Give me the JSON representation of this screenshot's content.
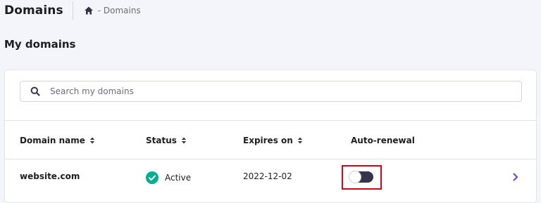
{
  "header": {
    "title": "Domains",
    "breadcrumb": "- Domains"
  },
  "section": {
    "title": "My domains"
  },
  "search": {
    "placeholder": "Search my domains",
    "value": ""
  },
  "table": {
    "columns": [
      "Domain name",
      "Status",
      "Expires on",
      "Auto-renewal"
    ],
    "rows": [
      {
        "domain": "website.com",
        "status": "Active",
        "expires": "2022-12-02",
        "auto_renewal": "off"
      }
    ]
  },
  "colors": {
    "accent": "#673de6",
    "status_active": "#00b090",
    "highlight": "#e0001a",
    "toggle_track": "#36344d"
  },
  "icons": {
    "home": "home-icon",
    "search": "search-icon",
    "sort": "sort-icon",
    "status": "check-circle-icon",
    "row_action": "chevron-right-icon"
  }
}
